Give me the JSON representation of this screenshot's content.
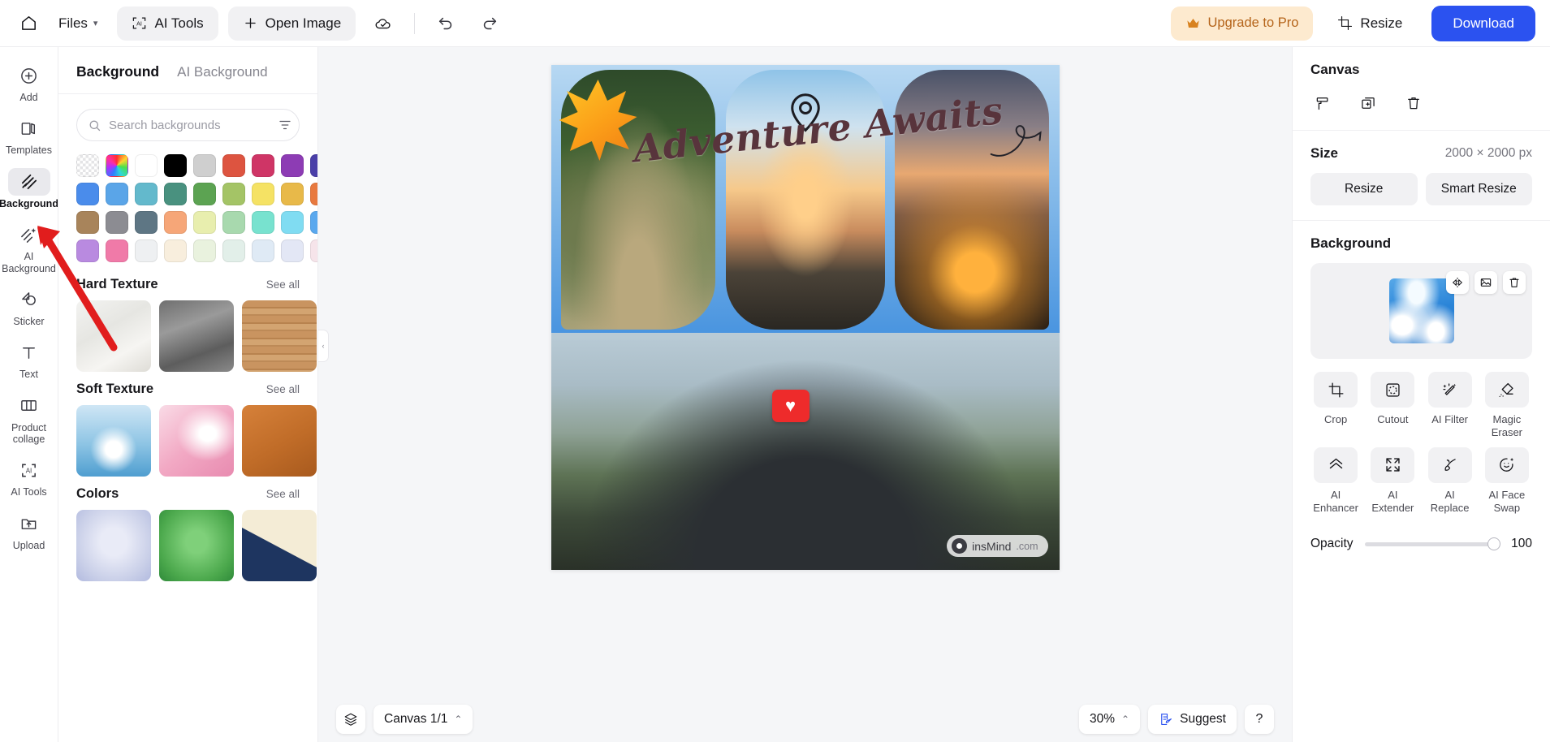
{
  "topbar": {
    "home_icon": "home-icon",
    "files_label": "Files",
    "ai_tools_label": "AI Tools",
    "open_image_label": "Open Image",
    "cloud_icon": "cloud-saved-icon",
    "undo_icon": "undo-icon",
    "redo_icon": "redo-icon",
    "upgrade_label": "Upgrade to Pro",
    "upgrade_icon": "crown-icon",
    "upgrade_color": "#b5641a",
    "upgrade_bg": "#fdeacf",
    "resize_label": "Resize",
    "download_label": "Download",
    "download_color": "#2b52f0"
  },
  "rail": {
    "items": [
      {
        "label": "Add",
        "icon": "plus-circle-icon",
        "active": false
      },
      {
        "label": "Templates",
        "icon": "templates-icon",
        "active": false
      },
      {
        "label": "Background",
        "icon": "background-hatch-icon",
        "active": true
      },
      {
        "label": "AI Background",
        "icon": "ai-background-icon",
        "active": false
      },
      {
        "label": "Sticker",
        "icon": "sticker-icon",
        "active": false
      },
      {
        "label": "Text",
        "icon": "text-t-icon",
        "active": false
      },
      {
        "label": "Product collage",
        "icon": "collage-icon",
        "active": false
      },
      {
        "label": "AI Tools",
        "icon": "ai-brackets-icon",
        "active": false
      },
      {
        "label": "Upload",
        "icon": "upload-folder-icon",
        "active": false
      }
    ]
  },
  "panel": {
    "tabs": [
      {
        "label": "Background",
        "active": true
      },
      {
        "label": "AI Background",
        "active": false
      }
    ],
    "search": {
      "placeholder": "Search backgrounds",
      "value": "",
      "icon": "search-icon",
      "filter_icon": "filter-icon"
    },
    "swatches": [
      "transparent",
      "rainbow",
      "#ffffff",
      "#000000",
      "#cfcfcf",
      "#dd5440",
      "#cf3566",
      "#8d3cb4",
      "#4a3fa8",
      "#4a8ceb",
      "#5aa5e8",
      "#63b9cc",
      "#49917f",
      "#5ca352",
      "#a4c466",
      "#f5e264",
      "#e8b949",
      "#e8793f",
      "#a8845b",
      "#8c8c92",
      "#5e7684",
      "#f6a678",
      "#e8eeae",
      "#a8d9ae",
      "#78e2cf",
      "#80dcf2",
      "#5aa8ee",
      "#b98ae0",
      "#f07aa8",
      "#eef0f2",
      "#f8eedd",
      "#e9f2de",
      "#e2efe9",
      "#dfeaf5",
      "#e3e7f5",
      "#f6e4ea"
    ],
    "sections": [
      {
        "title": "Hard Texture",
        "see_all": "See all",
        "items": [
          "marble-white",
          "concrete-grey",
          "wood-planks"
        ]
      },
      {
        "title": "Soft Texture",
        "see_all": "See all",
        "items": [
          "water-splash",
          "pink-silk",
          "orange-leather"
        ]
      },
      {
        "title": "Colors",
        "see_all": "See all",
        "items": [
          "lavender-gradient",
          "green-gradient",
          "navy-cream-split"
        ]
      }
    ]
  },
  "canvas": {
    "collapse_icon": "chevron-left-icon",
    "artwork": {
      "headline": "Adventure Awaits",
      "headline_color": "#58343c",
      "sticker_leaf": "maple-leaf-sticker",
      "sticker_heart": "heart-badge-sticker",
      "sticker_arrow": "curved-arrow-doodle",
      "sticker_pin": "location-pin-icon",
      "watermark": "insMind",
      "watermark_suffix": ".com"
    },
    "bottom": {
      "layers_icon": "layers-icon",
      "canvas_label": "Canvas 1/1",
      "canvas_chevron": "chevron-up-icon",
      "zoom_label": "30%",
      "zoom_chevron": "chevron-up-icon",
      "suggest_label": "Suggest",
      "suggest_icon": "suggest-note-icon",
      "help_label": "?"
    }
  },
  "right": {
    "canvas_title": "Canvas",
    "canvas_icons": [
      "paint-roller-icon",
      "duplicate-icon",
      "trash-icon"
    ],
    "size_label": "Size",
    "size_value": "2000 × 2000 px",
    "resize_label": "Resize",
    "smart_resize_label": "Smart Resize",
    "background_title": "Background",
    "bg_thumb": "sky-clouds-thumbnail",
    "bg_tools": [
      "flip-icon",
      "replace-image-icon",
      "trash-icon"
    ],
    "tools": [
      {
        "label": "Crop",
        "icon": "crop-icon"
      },
      {
        "label": "Cutout",
        "icon": "cutout-icon"
      },
      {
        "label": "AI Filter",
        "icon": "ai-filter-wand-icon"
      },
      {
        "label": "Magic Eraser",
        "icon": "magic-eraser-icon"
      },
      {
        "label": "AI Enhancer",
        "icon": "ai-enhancer-chevrons-icon"
      },
      {
        "label": "AI Extender",
        "icon": "ai-extender-expand-icon"
      },
      {
        "label": "AI Replace",
        "icon": "ai-replace-brush-icon"
      },
      {
        "label": "AI Face Swap",
        "icon": "ai-face-swap-icon"
      }
    ],
    "opacity_label": "Opacity",
    "opacity_value": "100"
  },
  "annotation": {
    "arrow": "red-pointer-arrow",
    "arrow_color": "#e11d1d"
  }
}
